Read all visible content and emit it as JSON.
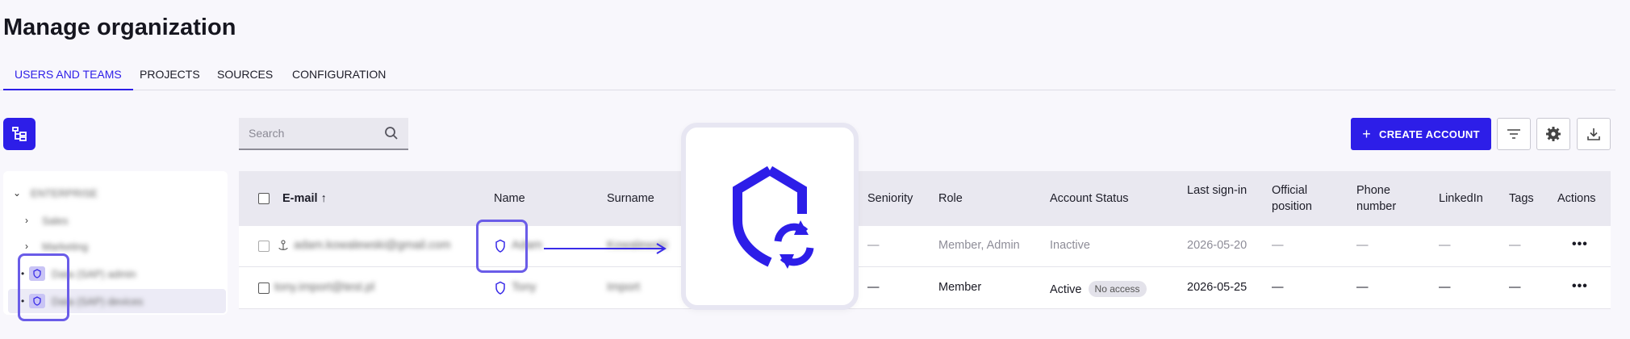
{
  "page": {
    "title": "Manage organization"
  },
  "tabs": [
    {
      "label": "USERS AND TEAMS",
      "active": true
    },
    {
      "label": "PROJECTS"
    },
    {
      "label": "SOURCES"
    },
    {
      "label": "CONFIGURATION"
    }
  ],
  "toolbar": {
    "search_placeholder": "Search",
    "create_label": "CREATE ACCOUNT",
    "create_plus": "+",
    "accent": "#2d1ee8"
  },
  "tree": {
    "items": [
      {
        "label": "ENTERPRISE",
        "chevron": "⌄"
      },
      {
        "label": "Sales",
        "chevron": "›"
      },
      {
        "label": "Marketing",
        "chevron": "›"
      },
      {
        "label": "Data (SAP) admin",
        "bullet": "•"
      },
      {
        "label": "Data (SAP) devices",
        "bullet": "•"
      }
    ]
  },
  "table": {
    "headers": {
      "email": "E-mail",
      "sort_arrow": "↑",
      "name": "Name",
      "surname": "Surname",
      "seniority": "Seniority",
      "role": "Role",
      "status": "Account Status",
      "last_sign_in": "Last sign-in",
      "official_position": "Official position",
      "phone": "Phone number",
      "linkedin": "LinkedIn",
      "tags": "Tags",
      "actions": "Actions"
    },
    "rows": [
      {
        "email": "adam.kowalewski@gmail.com",
        "name": "Adam",
        "surname": "Kowalewski",
        "seniority": "—",
        "role": "Member, Admin",
        "status": "Inactive",
        "no_access": "",
        "last_sign_in": "2026-05-20",
        "official_position": "—",
        "phone": "—",
        "linkedin": "—",
        "tags": "—",
        "actions": "•••"
      },
      {
        "email": "tony.import@test.pl",
        "name": "Tony",
        "surname": "Import",
        "seniority": "—",
        "role": "Member",
        "status": "Active",
        "no_access": "No access",
        "last_sign_in": "2026-05-25",
        "official_position": "—",
        "phone": "—",
        "linkedin": "—",
        "tags": "—",
        "actions": "•••"
      }
    ]
  },
  "icons": {
    "tree_toggle": "org-tree-icon",
    "search": "search-icon",
    "filter": "filter-icon",
    "settings": "gear-icon",
    "download": "download-icon",
    "sync_shield": "shield-sync-icon"
  }
}
